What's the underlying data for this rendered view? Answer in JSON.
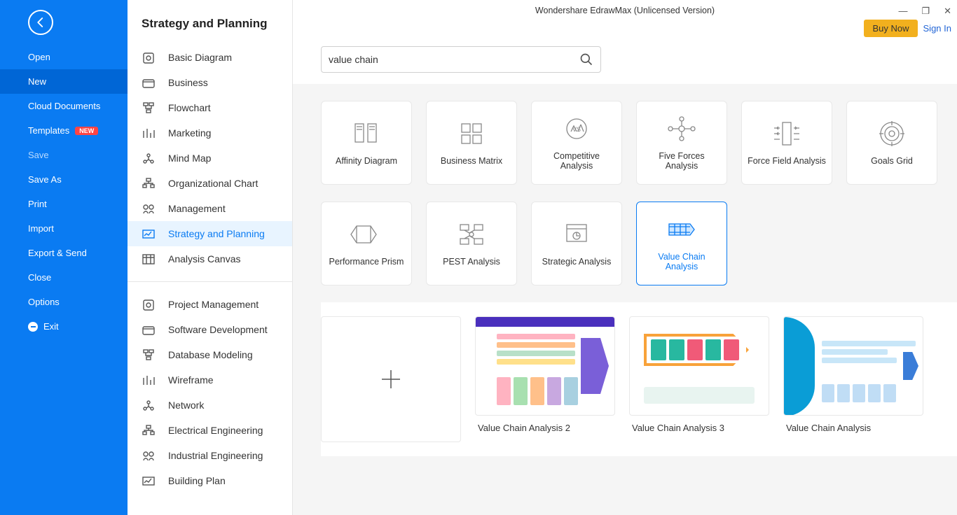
{
  "app_title": "Wondershare EdrawMax (Unlicensed Version)",
  "auth": {
    "buy": "Buy Now",
    "signin": "Sign In"
  },
  "sidebar": {
    "items": [
      {
        "label": "Open"
      },
      {
        "label": "New",
        "active": true
      },
      {
        "label": "Cloud Documents"
      },
      {
        "label": "Templates",
        "badge": "NEW"
      },
      {
        "label": "Save",
        "disabled": true
      },
      {
        "label": "Save As"
      },
      {
        "label": "Print"
      },
      {
        "label": "Import"
      },
      {
        "label": "Export & Send"
      },
      {
        "label": "Close"
      },
      {
        "label": "Options"
      },
      {
        "label": "Exit",
        "icon": true
      }
    ]
  },
  "category": {
    "title": "Strategy and Planning",
    "group1": [
      "Basic Diagram",
      "Business",
      "Flowchart",
      "Marketing",
      "Mind Map",
      "Organizational Chart",
      "Management",
      "Strategy and Planning",
      "Analysis Canvas"
    ],
    "selected": "Strategy and Planning",
    "group2": [
      "Project Management",
      "Software Development",
      "Database Modeling",
      "Wireframe",
      "Network",
      "Electrical Engineering",
      "Industrial Engineering",
      "Building Plan"
    ]
  },
  "search": {
    "value": "value chain",
    "placeholder": ""
  },
  "typecards": [
    "Affinity Diagram",
    "Business Matrix",
    "Competitive Analysis",
    "Five Forces Analysis",
    "Force Field Analysis",
    "Goals Grid",
    "Performance Prism",
    "PEST Analysis",
    "Strategic Analysis",
    "Value Chain Analysis"
  ],
  "type_selected": "Value Chain Analysis",
  "templates": [
    {
      "label": ""
    },
    {
      "label": "Value Chain Analysis 2"
    },
    {
      "label": "Value Chain Analysis 3"
    },
    {
      "label": "Value Chain Analysis"
    }
  ]
}
